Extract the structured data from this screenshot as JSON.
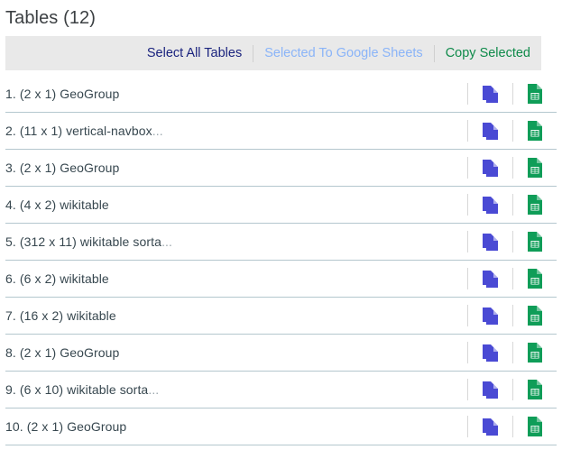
{
  "header": {
    "title": "Tables (12)"
  },
  "toolbar": {
    "select_all_label": "Select All Tables",
    "to_sheets_label": "Selected To Google Sheets",
    "copy_selected_label": "Copy Selected",
    "colors": {
      "primary": "#1a237e",
      "disabled": "#8ab4f8",
      "green": "#0f8a4a",
      "background": "#e9e9e9"
    }
  },
  "icons": {
    "copy": "copy-documents-icon",
    "sheets": "google-sheets-icon",
    "copy_color": "#4a4ad4",
    "sheets_color": "#0f9d58"
  },
  "list": {
    "divider_color": "#b4c7ce",
    "rows": [
      {
        "index": "1.",
        "dims": "(2 x 1)",
        "name": "GeoGroup",
        "ellipsis": ""
      },
      {
        "index": "2.",
        "dims": "(11 x 1)",
        "name": "vertical-navbox",
        "ellipsis": "..."
      },
      {
        "index": "3.",
        "dims": "(2 x 1)",
        "name": "GeoGroup",
        "ellipsis": ""
      },
      {
        "index": "4.",
        "dims": "(4 x 2)",
        "name": "wikitable",
        "ellipsis": ""
      },
      {
        "index": "5.",
        "dims": "(312 x 11)",
        "name": "wikitable sorta",
        "ellipsis": "..."
      },
      {
        "index": "6.",
        "dims": "(6 x 2)",
        "name": "wikitable",
        "ellipsis": ""
      },
      {
        "index": "7.",
        "dims": "(16 x 2)",
        "name": "wikitable",
        "ellipsis": ""
      },
      {
        "index": "8.",
        "dims": "(2 x 1)",
        "name": "GeoGroup",
        "ellipsis": ""
      },
      {
        "index": "9.",
        "dims": "(6 x 10)",
        "name": "wikitable sorta",
        "ellipsis": "..."
      },
      {
        "index": "10.",
        "dims": "(2 x 1)",
        "name": "GeoGroup",
        "ellipsis": ""
      }
    ]
  }
}
